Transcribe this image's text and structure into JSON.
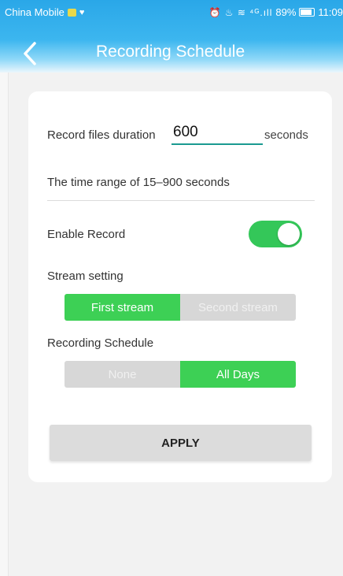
{
  "status_bar": {
    "carrier": "China Mobile",
    "signal_icons": "⏰ ♨ ≋ ⁴ᴳ.ıll",
    "battery": "89%",
    "time": "11:09"
  },
  "header": {
    "title": "Recording Schedule",
    "back_icon": "chevron-left-icon",
    "gradient_top": "#2aa7e8",
    "gradient_bottom": "#eaf6fc"
  },
  "form": {
    "duration_label": "Record files duration",
    "duration_value": "600",
    "duration_unit": "seconds",
    "range_hint": "The time range of 15–900 seconds",
    "enable_label": "Enable Record",
    "enable_value": true,
    "stream_label": "Stream setting",
    "stream_options": [
      "First stream",
      "Second stream"
    ],
    "stream_selected": "First stream",
    "schedule_label": "Recording Schedule",
    "schedule_options": [
      "None",
      "All Days"
    ],
    "schedule_selected": "All Days",
    "apply_label": "APPLY"
  },
  "colors": {
    "accent_green": "#3dd055",
    "input_underline": "#1b9a91",
    "inactive_gray": "#d7d7d7"
  }
}
